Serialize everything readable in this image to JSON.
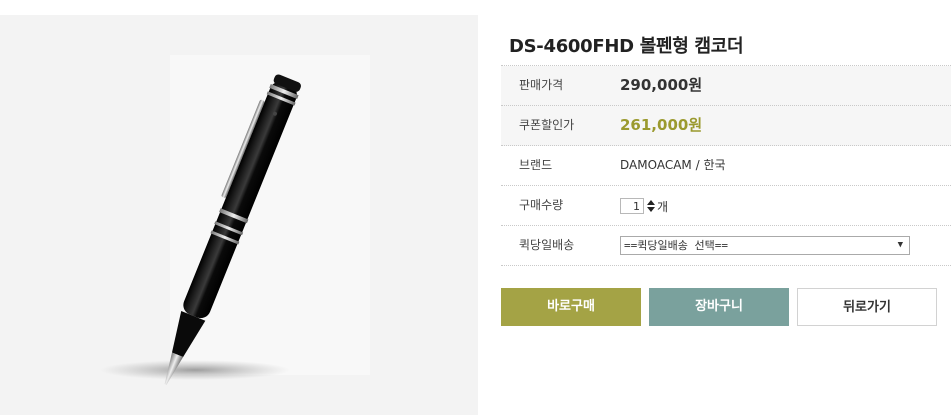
{
  "product": {
    "title": "DS-4600FHD 볼펜형 캠코더",
    "image_subject": "spy-camera-pen"
  },
  "info": {
    "price_label": "판매가격",
    "price_value": "290,000원",
    "coupon_label": "쿠폰할인가",
    "coupon_value": "261,000원",
    "brand_label": "브랜드",
    "brand_value": "DAMOACAM / 한국",
    "quantity_label": "구매수량",
    "quantity_value": "1",
    "quantity_unit": "개",
    "shipping_label": "퀵당일배송",
    "shipping_selected": "==퀵당일배송 선택=="
  },
  "buttons": {
    "buy": "바로구매",
    "cart": "장바구니",
    "back": "뒤로가기"
  },
  "colors": {
    "buy_button": "#a4a345",
    "cart_button": "#7aa19d",
    "coupon_price": "#9b9a2f"
  }
}
